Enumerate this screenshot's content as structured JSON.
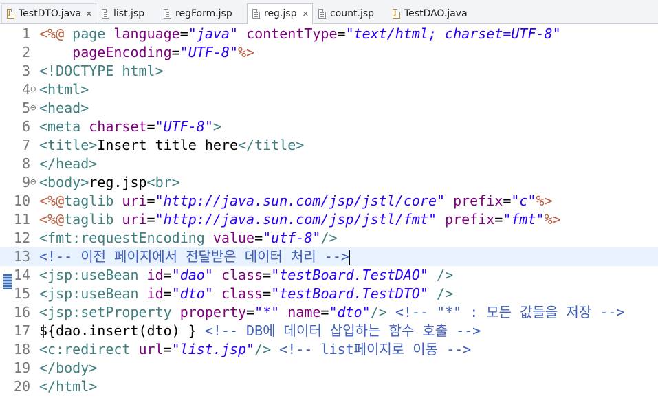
{
  "tabs": [
    {
      "label": "TestDTO.java",
      "icon": "java-file-icon",
      "closable": true,
      "active": false
    },
    {
      "label": "list.jsp",
      "icon": "jsp-file-icon",
      "closable": false,
      "active": false
    },
    {
      "label": "regForm.jsp",
      "icon": "jsp-file-icon",
      "closable": false,
      "active": false
    },
    {
      "label": "reg.jsp",
      "icon": "jsp-file-icon",
      "closable": true,
      "active": true
    },
    {
      "label": "count.jsp",
      "icon": "jsp-file-icon",
      "closable": false,
      "active": false
    },
    {
      "label": "TestDAO.java",
      "icon": "java-file-icon",
      "closable": false,
      "active": false
    }
  ],
  "close_glyph": "✕",
  "fold_glyph": "⊖",
  "editor": {
    "current_line": 13,
    "lines": [
      {
        "n": "1",
        "fold": false,
        "tokens": [
          [
            "jsp",
            "<%@ "
          ],
          [
            "tag",
            "page "
          ],
          [
            "attr",
            "language"
          ],
          [
            "plain",
            "="
          ],
          [
            "str",
            "\"java\""
          ],
          [
            "plain",
            " "
          ],
          [
            "attr",
            "contentType"
          ],
          [
            "plain",
            "="
          ],
          [
            "str",
            "\"text/html; charset=UTF-8\""
          ]
        ]
      },
      {
        "n": "2",
        "fold": false,
        "tokens": [
          [
            "plain",
            "    "
          ],
          [
            "attr",
            "pageEncoding"
          ],
          [
            "plain",
            "="
          ],
          [
            "str",
            "\"UTF-8\""
          ],
          [
            "jsp",
            "%>"
          ]
        ]
      },
      {
        "n": "3",
        "fold": false,
        "tokens": [
          [
            "tag",
            "<!DOCTYPE html>"
          ]
        ]
      },
      {
        "n": "4",
        "fold": true,
        "tokens": [
          [
            "tag",
            "<html>"
          ]
        ]
      },
      {
        "n": "5",
        "fold": true,
        "tokens": [
          [
            "tag",
            "<head>"
          ]
        ]
      },
      {
        "n": "6",
        "fold": false,
        "tokens": [
          [
            "tag",
            "<meta "
          ],
          [
            "attr",
            "charset"
          ],
          [
            "plain",
            "="
          ],
          [
            "str",
            "\"UTF-8\""
          ],
          [
            "tag",
            ">"
          ]
        ]
      },
      {
        "n": "7",
        "fold": false,
        "tokens": [
          [
            "tag",
            "<title>"
          ],
          [
            "plain",
            "Insert title here"
          ],
          [
            "tag",
            "</title>"
          ]
        ]
      },
      {
        "n": "8",
        "fold": false,
        "tokens": [
          [
            "tag",
            "</head>"
          ]
        ]
      },
      {
        "n": "9",
        "fold": true,
        "tokens": [
          [
            "tag",
            "<body>"
          ],
          [
            "plain",
            "reg.jsp"
          ],
          [
            "tag",
            "<br>"
          ]
        ]
      },
      {
        "n": "10",
        "fold": false,
        "tokens": [
          [
            "jsp",
            "<%@"
          ],
          [
            "tag",
            "taglib "
          ],
          [
            "attr",
            "uri"
          ],
          [
            "plain",
            "="
          ],
          [
            "str",
            "\"http://java.sun.com/jsp/jstl/core\""
          ],
          [
            "plain",
            " "
          ],
          [
            "attr",
            "prefix"
          ],
          [
            "plain",
            "="
          ],
          [
            "str",
            "\"c\""
          ],
          [
            "jsp",
            "%>"
          ]
        ]
      },
      {
        "n": "11",
        "fold": false,
        "tokens": [
          [
            "jsp",
            "<%@"
          ],
          [
            "tag",
            "taglib "
          ],
          [
            "attr",
            "uri"
          ],
          [
            "plain",
            "="
          ],
          [
            "str",
            "\"http://java.sun.com/jsp/jstl/fmt\""
          ],
          [
            "plain",
            " "
          ],
          [
            "attr",
            "prefix"
          ],
          [
            "plain",
            "="
          ],
          [
            "str",
            "\"fmt\""
          ],
          [
            "jsp",
            "%>"
          ]
        ]
      },
      {
        "n": "12",
        "fold": false,
        "tokens": [
          [
            "tag",
            "<fmt:requestEncoding "
          ],
          [
            "attr",
            "value"
          ],
          [
            "plain",
            "="
          ],
          [
            "str",
            "\"utf-8\""
          ],
          [
            "tag",
            "/>"
          ]
        ]
      },
      {
        "n": "13",
        "fold": false,
        "tokens": [
          [
            "com",
            "<!-- 이전 페이지에서 전달받은 데이터 처리 -->"
          ]
        ]
      },
      {
        "n": "14",
        "fold": false,
        "tokens": [
          [
            "tag",
            "<jsp:useBean "
          ],
          [
            "attr",
            "id"
          ],
          [
            "plain",
            "="
          ],
          [
            "str",
            "\"dao\""
          ],
          [
            "plain",
            " "
          ],
          [
            "attr",
            "class"
          ],
          [
            "plain",
            "="
          ],
          [
            "str",
            "\"testBoard.TestDAO\""
          ],
          [
            "plain",
            " "
          ],
          [
            "tag",
            "/>"
          ]
        ]
      },
      {
        "n": "15",
        "fold": false,
        "tokens": [
          [
            "tag",
            "<jsp:useBean "
          ],
          [
            "attr",
            "id"
          ],
          [
            "plain",
            "="
          ],
          [
            "str",
            "\"dto\""
          ],
          [
            "plain",
            " "
          ],
          [
            "attr",
            "class"
          ],
          [
            "plain",
            "="
          ],
          [
            "str",
            "\"testBoard.TestDTO\""
          ],
          [
            "plain",
            " "
          ],
          [
            "tag",
            "/>"
          ]
        ]
      },
      {
        "n": "16",
        "fold": false,
        "tokens": [
          [
            "tag",
            "<jsp:setProperty "
          ],
          [
            "attr",
            "property"
          ],
          [
            "plain",
            "="
          ],
          [
            "str",
            "\"*\""
          ],
          [
            "plain",
            " "
          ],
          [
            "attr",
            "name"
          ],
          [
            "plain",
            "="
          ],
          [
            "str",
            "\"dto\""
          ],
          [
            "tag",
            "/>"
          ],
          [
            "plain",
            " "
          ],
          [
            "com",
            "<!-- \"*\" : 모든 값들을 저장 -->"
          ]
        ]
      },
      {
        "n": "17",
        "fold": false,
        "tokens": [
          [
            "plain",
            "${dao.insert(dto) } "
          ],
          [
            "com",
            "<!-- DB에 데이터 삽입하는 함수 호출 -->"
          ]
        ]
      },
      {
        "n": "18",
        "fold": false,
        "tokens": [
          [
            "tag",
            "<c:redirect "
          ],
          [
            "attr",
            "url"
          ],
          [
            "plain",
            "="
          ],
          [
            "str",
            "\"list.jsp\""
          ],
          [
            "tag",
            "/>"
          ],
          [
            "plain",
            " "
          ],
          [
            "com",
            "<!-- list페이지로 이동 -->"
          ]
        ]
      },
      {
        "n": "19",
        "fold": false,
        "tokens": [
          [
            "tag",
            "</body>"
          ]
        ]
      },
      {
        "n": "20",
        "fold": false,
        "tokens": [
          [
            "tag",
            "</html>"
          ]
        ]
      }
    ]
  }
}
